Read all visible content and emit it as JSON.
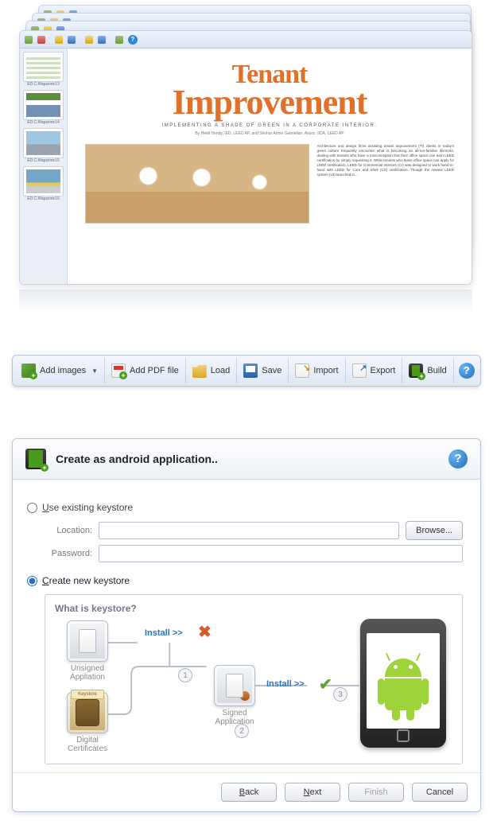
{
  "editor": {
    "thumbnails": [
      {
        "caption": "ED.C.Magazine13"
      },
      {
        "caption": "ED.C.Magazine14"
      },
      {
        "caption": "ED.C.Magazine15"
      },
      {
        "caption": "ED.C.Magazine16"
      }
    ],
    "page": {
      "title_line1": "Tenant",
      "title_line2": "Improvement",
      "subtitle": "IMPLEMENTING A SHADE OF GREEN IN A CORPORATE INTERIOR.",
      "byline": "By Heidi Hendy, IED, LEED AP, and Shohar Annie Gabrielian, Assoc. IIDA, LEED AP",
      "body": "Architecture and design firms assisting tenant improvement (TI) clients in today's green culture frequently encounter what is becoming an all-too-familiar dilemma: dealing with tenants who have a misconception that their office space can earn LEED certification by simply requesting it. While tenants who lease office space can apply for LEED certification, LEED for Commercial Interiors (CI) was designed to work hand-in-hand with LEED for Core and Shell (CS) certification. Though the newest LEED system (v3) launched in..."
    }
  },
  "toolbar": {
    "add_images": "Add images",
    "add_pdf": "Add PDF file",
    "load": "Load",
    "save": "Save",
    "import": "Import",
    "export": "Export",
    "build": "Build",
    "help_glyph": "?"
  },
  "dialog": {
    "title": "Create as android application..",
    "help_glyph": "?",
    "radio_existing": "Use existing keystore",
    "radio_new": "Create new keystore",
    "selected_option": "new",
    "location_label": "Location:",
    "location_value": "",
    "password_label": "Password:",
    "password_value": "",
    "browse": "Browse...",
    "info_heading": "What is keystore?",
    "diagram": {
      "unsigned": "Unsigned Appliation",
      "keystore": "Digital Certificates",
      "signed": "Signed Application",
      "install": "Install >>",
      "step1": "1",
      "step2": "2",
      "step3": "3"
    },
    "buttons": {
      "back": "Back",
      "next": "Next",
      "finish": "Finish",
      "cancel": "Cancel"
    }
  }
}
